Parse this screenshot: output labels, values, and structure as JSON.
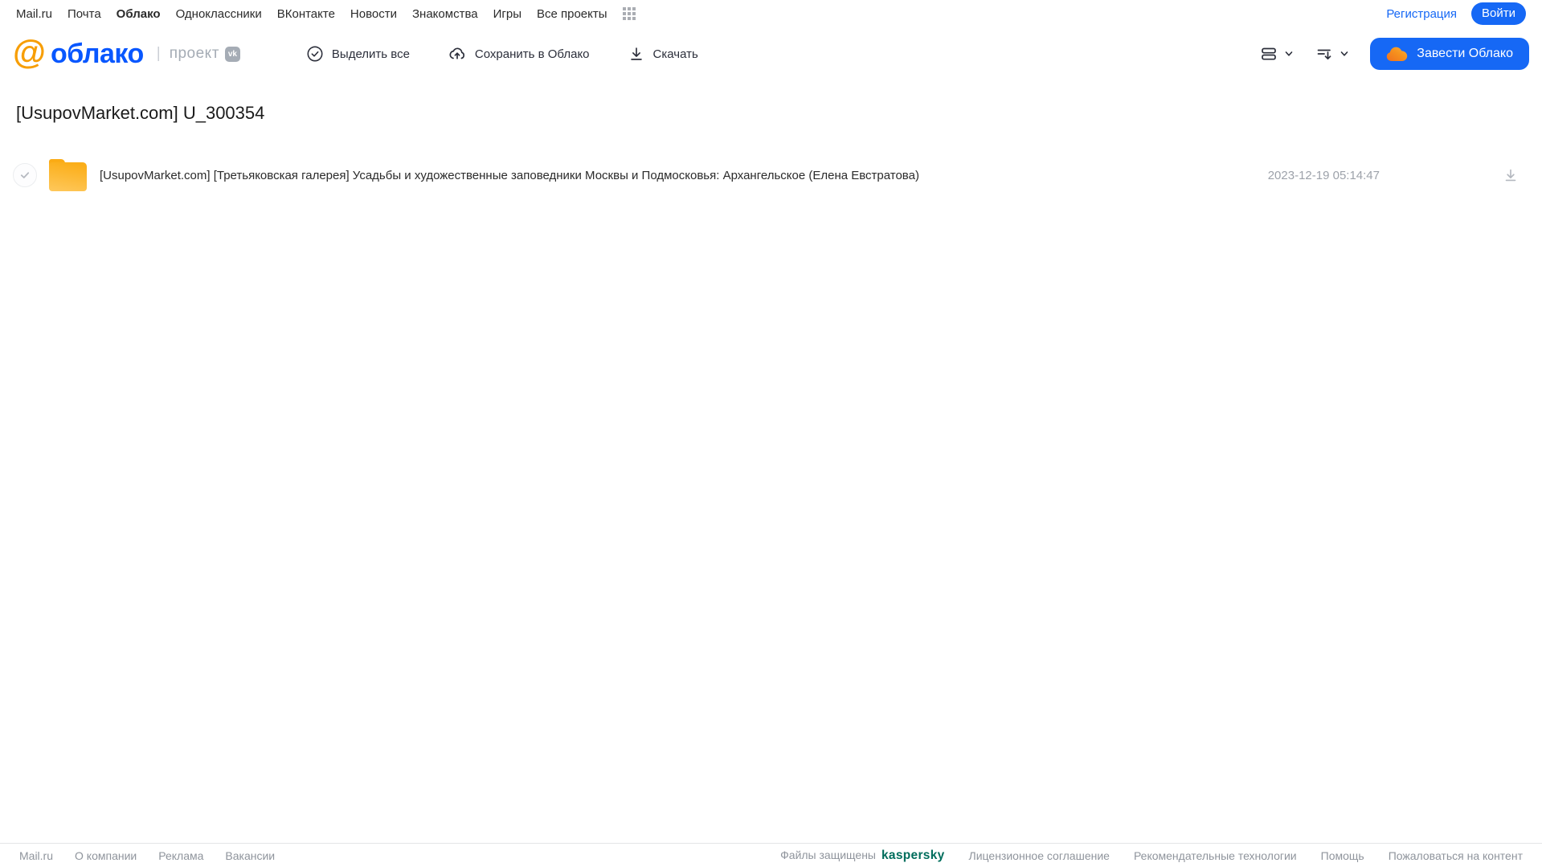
{
  "topnav": {
    "items": [
      "Mail.ru",
      "Почта",
      "Облако",
      "Одноклассники",
      "ВКонтакте",
      "Новости",
      "Знакомства",
      "Игры",
      "Все проекты"
    ],
    "active_item": "Облако",
    "register_label": "Регистрация",
    "login_label": "Войти"
  },
  "header": {
    "logo_at": "@",
    "logo_text": "облако",
    "divider": "|",
    "project_label": "проект",
    "vk_badge": "vk",
    "toolbar": {
      "select_all": "Выделить все",
      "save_to_cloud": "Сохранить в Облако",
      "download": "Скачать"
    },
    "get_cloud_label": "Завести Облако"
  },
  "page": {
    "title": "[UsupovMarket.com] U_300354"
  },
  "files": [
    {
      "type": "folder",
      "name": "[UsupovMarket.com] [Третьяковская галерея] Усадьбы и художественные заповедники Москвы и Подмосковья: Архангельское (Елена Евстратова)",
      "modified": "2023-12-19 05:14:47"
    }
  ],
  "footer": {
    "left_links": [
      "Mail.ru",
      "О компании",
      "Реклама",
      "Вакансии"
    ],
    "protected_label": "Файлы защищены",
    "kaspersky_label": "kaspersky",
    "right_links": [
      "Лицензионное соглашение",
      "Рекомендательные технологии",
      "Помощь",
      "Пожаловаться на контент"
    ]
  },
  "colors": {
    "accent_blue": "#1668f5",
    "logo_blue": "#0857ff",
    "logo_orange": "#f79e05",
    "folder_yellow": "#fbae19",
    "kaspersky_teal": "#006d5c",
    "muted_gray": "#a5acb5"
  }
}
